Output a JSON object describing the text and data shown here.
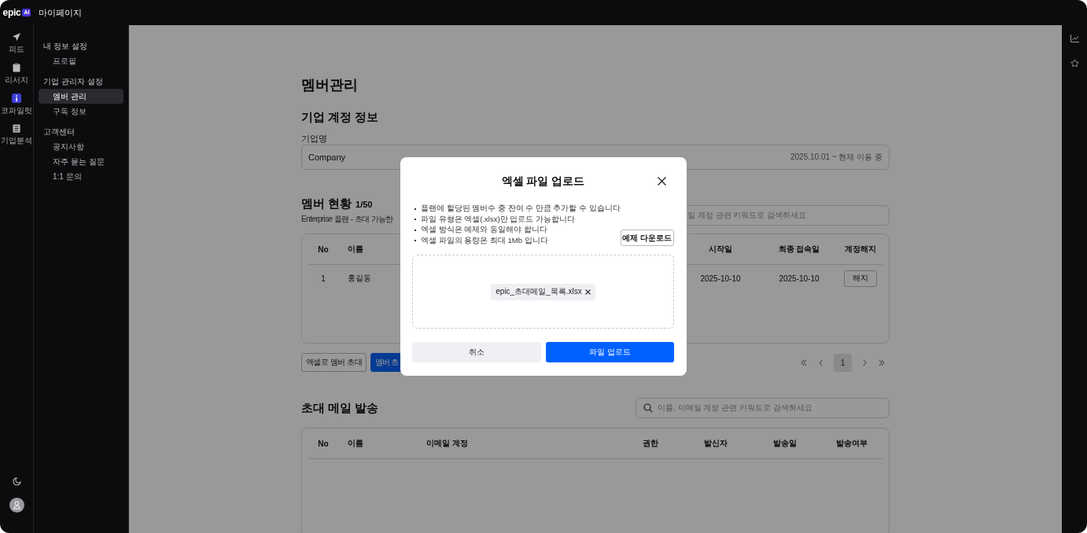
{
  "top_bar": {
    "logo": "epic",
    "logo_badge": "AI",
    "title": "마이페이지"
  },
  "nav_rail": {
    "items": [
      {
        "label": "피드",
        "kind": "send",
        "selected": false
      },
      {
        "label": "리서치",
        "kind": "clipboard",
        "selected": false
      },
      {
        "label": "코파일럿",
        "kind": "copilot",
        "selected": false
      },
      {
        "label": "기업분석",
        "kind": "building",
        "selected": false
      }
    ]
  },
  "sidebar": {
    "groups": [
      {
        "heading": "내 정보 설정",
        "items": [
          {
            "label": "프로필",
            "selected": false
          }
        ]
      },
      {
        "heading": "기업 관리자 설정",
        "items": [
          {
            "label": "멤버 관리",
            "selected": true
          },
          {
            "label": "구독 정보",
            "selected": false
          }
        ]
      },
      {
        "heading": "고객센터",
        "items": [
          {
            "label": "공지사항",
            "selected": false
          },
          {
            "label": "자주 묻는 질문",
            "selected": false
          },
          {
            "label": "1:1 문의",
            "selected": false
          }
        ]
      }
    ]
  },
  "page": {
    "title": "멤버관리"
  },
  "company_section": {
    "heading": "기업 계정 정보",
    "field_label": "기업명",
    "value": "Company",
    "period": "2025.10.01 ~ 현재 이용 중"
  },
  "members_section": {
    "heading": "멤버 현황",
    "count": "1/50",
    "plan_note": "Enterprise 플랜 - 초대 가능한",
    "search": {
      "placeholder": "일 계정 관련 키워드로 검색하세요"
    },
    "table": {
      "columns": [
        "No",
        "이름",
        "시작일",
        "최종 접속일",
        "계정해지"
      ],
      "rows": [
        {
          "cells": [
            "1",
            "홍길동",
            "2025-10-10",
            "2025-10-10"
          ],
          "action": "해지"
        }
      ]
    },
    "buttons": [
      {
        "label": "엑셀로 멤버 초대",
        "kind": "outline"
      },
      {
        "label": "멤버 초",
        "kind": "primary"
      }
    ],
    "pagination": {
      "pages": [
        {
          "label": "1",
          "selected": true
        }
      ]
    }
  },
  "invite_section": {
    "heading": "초대 메일 발송",
    "search": {
      "placeholder": "이름, 이메일 계정 관련 키워드로 검색하세요"
    },
    "table": {
      "columns": [
        "No",
        "이름",
        "이메일 계정",
        "권한",
        "발신자",
        "발송일",
        "발송여부"
      ]
    }
  },
  "modal": {
    "title": "엑셀 파일 업로드",
    "notes": [
      "플랜에 할당된 멤버수 중 잔여 수 만큼 추가할 수 있습니다",
      "파일 유형은 엑셀(.xlsx)만 업로드 가능합니다",
      "엑셀 방식은 예제와 동일해야 합니다",
      "엑셀 파일의 용량은 최대 1Mb 입니다"
    ],
    "example_button": "예제 다운로드",
    "file": {
      "name": "epic_초대메일_목록.xlsx"
    },
    "buttons": [
      {
        "label": "취소",
        "kind": "secondary"
      },
      {
        "label": "파일 업로드",
        "kind": "primary"
      }
    ]
  }
}
